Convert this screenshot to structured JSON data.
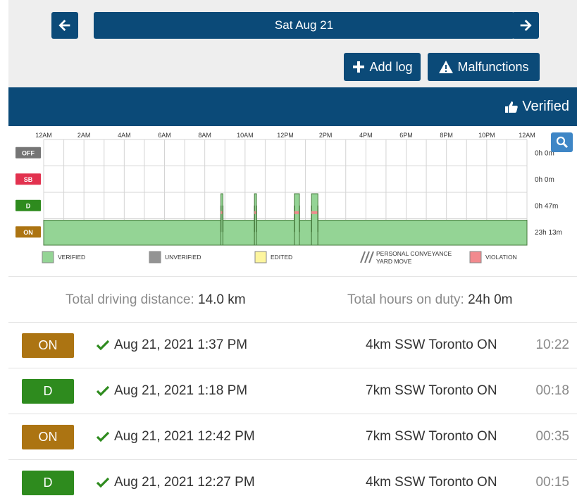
{
  "nav": {
    "date": "Sat Aug 21",
    "add_log_label": "Add log",
    "malfunctions_label": "Malfunctions"
  },
  "status_banner": {
    "label": "Verified"
  },
  "chart": {
    "time_labels": [
      "12AM",
      "2AM",
      "4AM",
      "6AM",
      "8AM",
      "10AM",
      "12PM",
      "2PM",
      "4PM",
      "6PM",
      "8PM",
      "10PM",
      "12AM"
    ],
    "rows": [
      {
        "label": "OFF",
        "color": "#757575",
        "total": "0h 0m"
      },
      {
        "label": "SB",
        "color": "#e2324f",
        "total": "0h 0m"
      },
      {
        "label": "D",
        "color": "#2e8b1e",
        "total": "0h 47m"
      },
      {
        "label": "ON",
        "color": "#ac7412",
        "total": "23h 13m"
      }
    ],
    "segments": [
      {
        "row": "ON",
        "start": "00:00",
        "end": "08:48"
      },
      {
        "row": "D",
        "start": "08:48",
        "end": "08:54"
      },
      {
        "row": "ON",
        "start": "08:54",
        "end": "10:28"
      },
      {
        "row": "D",
        "start": "10:28",
        "end": "10:34"
      },
      {
        "row": "ON",
        "start": "10:34",
        "end": "12:27"
      },
      {
        "row": "D",
        "start": "12:27",
        "end": "12:42"
      },
      {
        "row": "ON",
        "start": "12:42",
        "end": "13:18"
      },
      {
        "row": "D",
        "start": "13:18",
        "end": "13:37"
      },
      {
        "row": "ON",
        "start": "13:37",
        "end": "24:00"
      }
    ],
    "legend": [
      {
        "label": "VERIFIED",
        "color": "#94d495",
        "stripes": false
      },
      {
        "label": "UNVERIFIED",
        "color": "#939393",
        "stripes": false
      },
      {
        "label": "EDITED",
        "color": "#fdf59e",
        "stripes": false
      },
      {
        "label": "PERSONAL CONVEYANCE",
        "label2": "YARD MOVE",
        "color": "#cccccc",
        "stripes": true
      },
      {
        "label": "VIOLATION",
        "color": "#f28a8e",
        "stripes": false
      }
    ]
  },
  "totals": {
    "distance_label": "Total driving distance:",
    "distance_value": "14.0 km",
    "duty_label": "Total hours on duty:",
    "duty_value": "24h 0m"
  },
  "logs": [
    {
      "status": "ON",
      "color": "#ac7412",
      "time": "Aug 21, 2021 1:37 PM",
      "location": "4km SSW Toronto ON",
      "duration": "10:22"
    },
    {
      "status": "D",
      "color": "#2e8b1e",
      "time": "Aug 21, 2021 1:18 PM",
      "location": "7km SSW Toronto ON",
      "duration": "00:18"
    },
    {
      "status": "ON",
      "color": "#ac7412",
      "time": "Aug 21, 2021 12:42 PM",
      "location": "7km SSW Toronto ON",
      "duration": "00:35"
    },
    {
      "status": "D",
      "color": "#2e8b1e",
      "time": "Aug 21, 2021 12:27 PM",
      "location": "4km SSW Toronto ON",
      "duration": "00:15"
    }
  ]
}
